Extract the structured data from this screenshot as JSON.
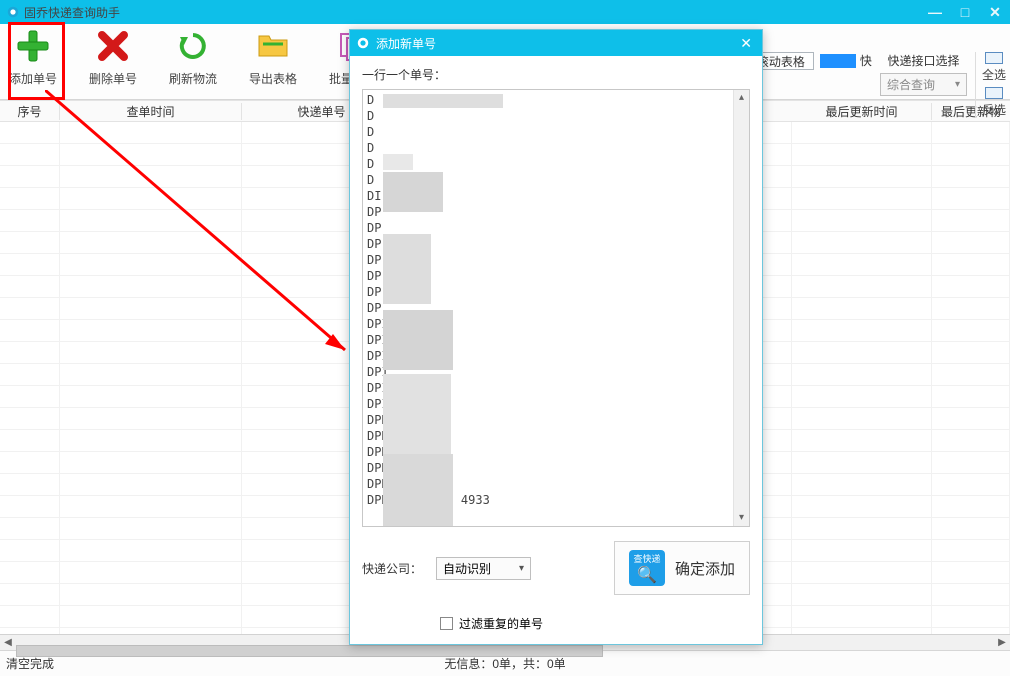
{
  "titlebar": {
    "title": "固乔快递查询助手"
  },
  "toolbar": {
    "addLabel": "添加单号",
    "deleteLabel": "删除单号",
    "refreshLabel": "刷新物流",
    "exportLabel": "导出表格",
    "copyLabel": "批量复制",
    "scrollSheet": "滚动表格",
    "fast": "快",
    "interfaceTitle": "快递接口选择",
    "interfaceValue": "综合查询",
    "selectAll": "全选",
    "invert": "反选"
  },
  "headers": {
    "num": "序号",
    "time": "查单时间",
    "track": "快递单号",
    "update": "最后更新时间",
    "last": "最后更新物"
  },
  "statusbar": {
    "left": "清空完成",
    "mid": "无信息：0单，共：0单"
  },
  "modal": {
    "title": "添加新单号",
    "hint": "一行一个单号：",
    "textLines": [
      "D",
      "D",
      "D",
      "D",
      "D",
      "D",
      "DI",
      "DP",
      "DP",
      "DP",
      "DP",
      "DP",
      "DP",
      "DP",
      "DPI",
      "DPI",
      "DPI",
      "DPI",
      "DPI",
      "DPI",
      "DPK",
      "DPK",
      "DPK",
      "DPK",
      "DPK",
      "DPK3         4933"
    ],
    "companyLabel": "快递公司：",
    "companyValue": "自动识别",
    "filterLabel": "过滤重复的单号",
    "confirmIconText": "查快递",
    "confirm": "确定添加"
  }
}
